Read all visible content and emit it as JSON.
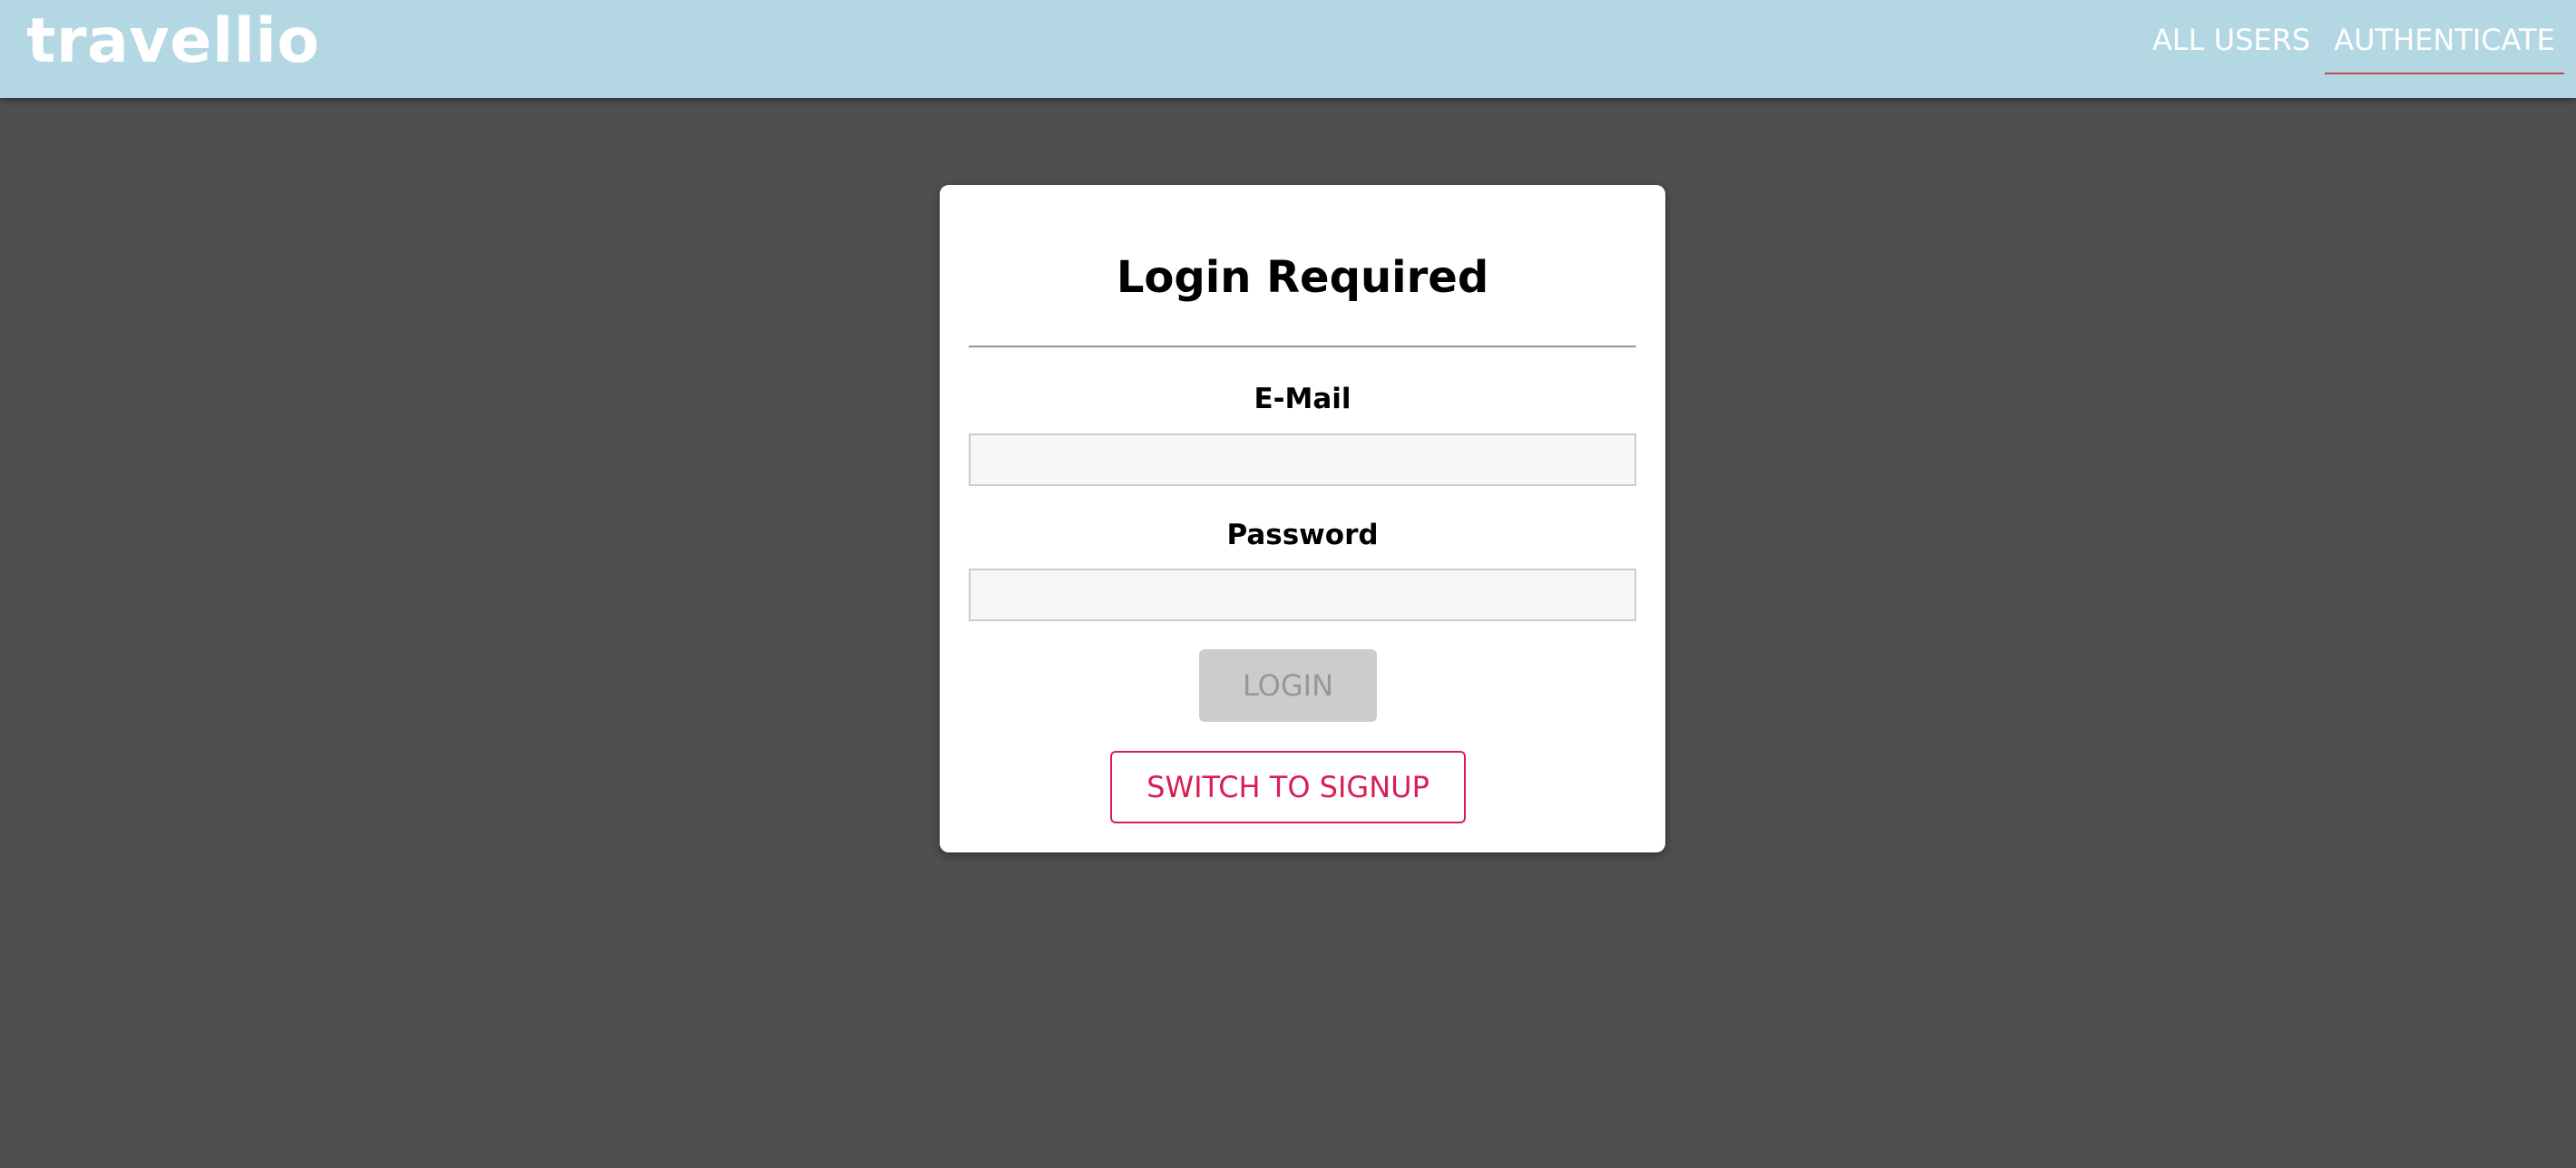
{
  "header": {
    "logo": "travellio",
    "nav": {
      "all_users": "ALL USERS",
      "authenticate": "AUTHENTICATE"
    }
  },
  "auth_card": {
    "title": "Login Required",
    "email_label": "E-Mail",
    "email_value": "",
    "password_label": "Password",
    "password_value": "",
    "login_button": "LOGIN",
    "switch_button": "SWITCH TO SIGNUP"
  },
  "colors": {
    "header_bg": "#b4d8e3",
    "page_bg": "#4f4f4f",
    "accent": "#d81f55",
    "active_underline": "#b9514a",
    "disabled_button_bg": "#cccccc"
  }
}
